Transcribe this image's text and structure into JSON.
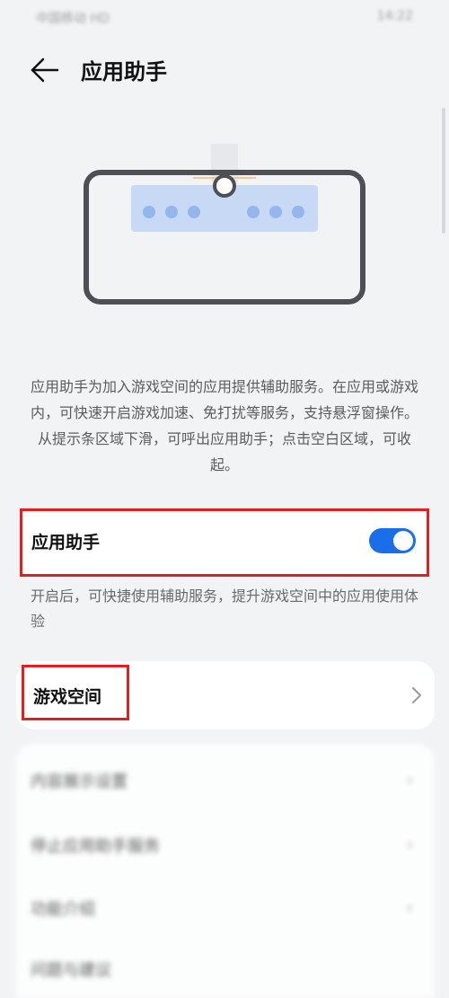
{
  "status_bar": {
    "left_text": "中国移动 HD",
    "right_text": "14:22"
  },
  "header": {
    "title": "应用助手"
  },
  "description": "应用助手为加入游戏空间的应用提供辅助服务。在应用或游戏内，可快速开启游戏加速、免打扰等服务，支持悬浮窗操作。从提示条区域下滑，可呼出应用助手；点击空白区域，可收起。",
  "toggle": {
    "label": "应用助手",
    "state": "on",
    "description": "开启后，可快捷使用辅助服务，提升游戏空间中的应用使用体验"
  },
  "game_space": {
    "label": "游戏空间"
  },
  "settings_list": [
    {
      "label": "内容展示设置"
    },
    {
      "label": "停止应用助手服务"
    },
    {
      "label": "功能介绍"
    },
    {
      "label": "问题与建议"
    }
  ],
  "colors": {
    "accent": "#1a6fe8",
    "highlight_border": "#e02020",
    "background": "#f1f3f5"
  }
}
